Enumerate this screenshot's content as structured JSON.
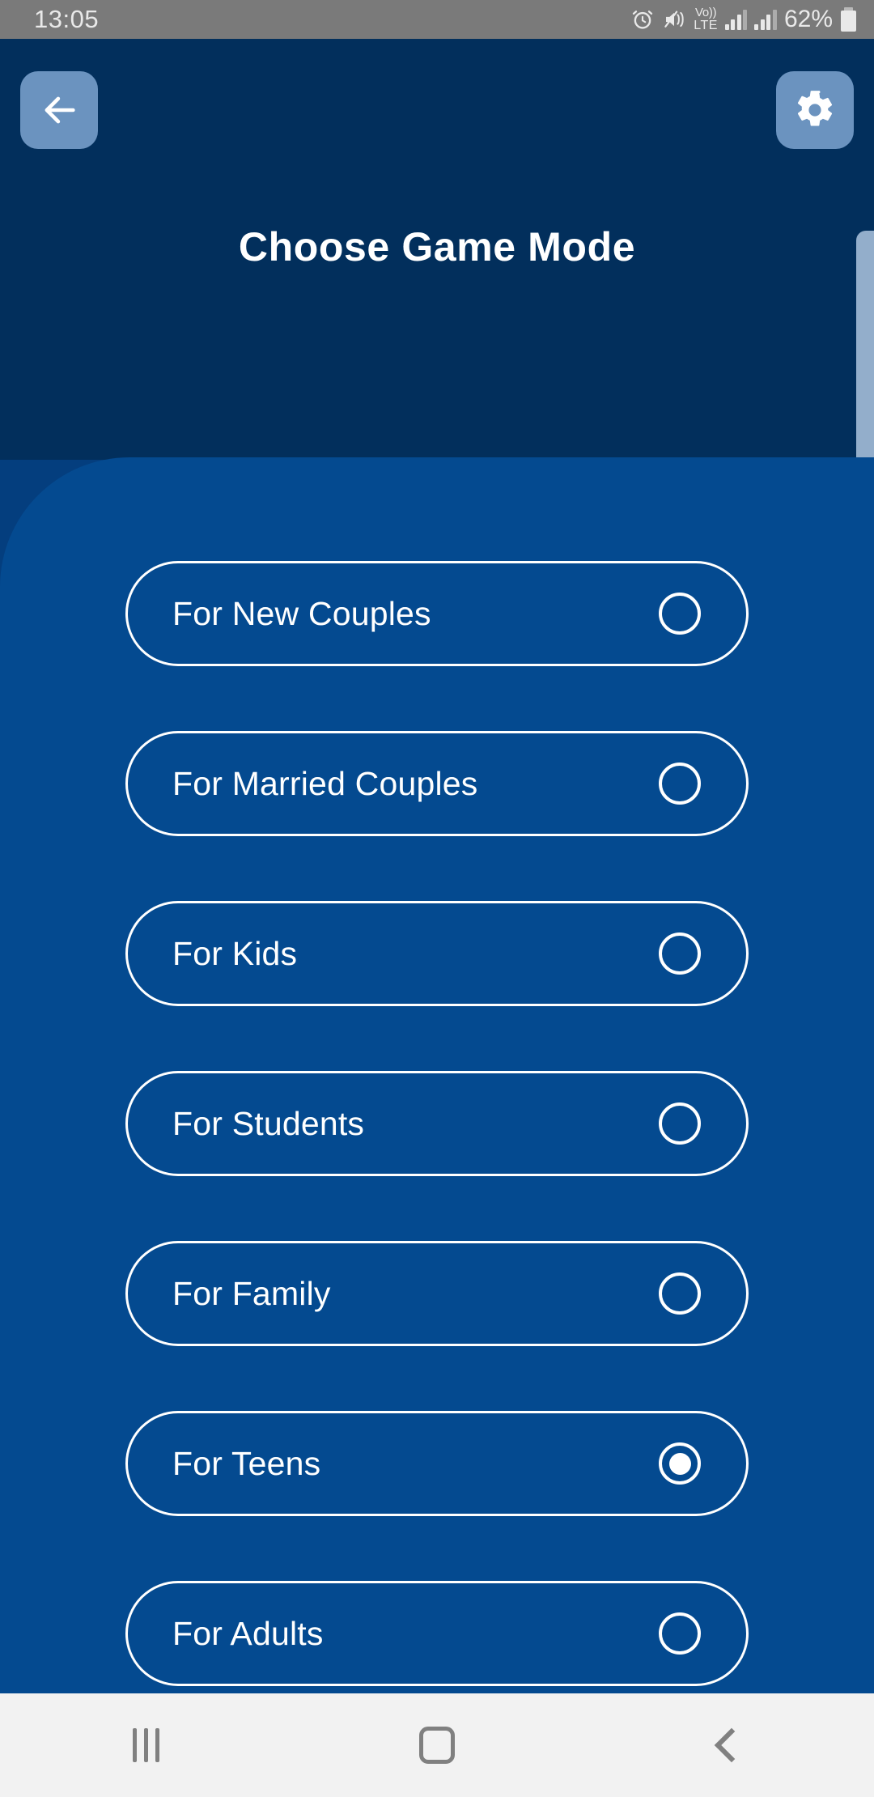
{
  "status_bar": {
    "time": "13:05",
    "battery_percent": "62%",
    "network_top": "Vo))",
    "network_bottom": "LTE",
    "icons": [
      "alarm-icon",
      "mute-vibrate-icon",
      "volte-icon",
      "signal-bars-sim1",
      "signal-bars-sim2",
      "battery-icon"
    ]
  },
  "header": {
    "title": "Choose Game Mode",
    "back_button": "back-arrow",
    "settings_button": "gear",
    "background_color": "#022f5c",
    "button_color": "#6b93bf"
  },
  "panel": {
    "background_color": "#044a90"
  },
  "options": [
    {
      "label": "For New Couples",
      "selected": false
    },
    {
      "label": "For Married Couples",
      "selected": false
    },
    {
      "label": "For Kids",
      "selected": false
    },
    {
      "label": "For Students",
      "selected": false
    },
    {
      "label": "For Family",
      "selected": false
    },
    {
      "label": "For Teens",
      "selected": true
    },
    {
      "label": "For Adults",
      "selected": false
    }
  ],
  "selected_option": "For Teens",
  "bottom_nav": {
    "recents": "recents-icon",
    "home": "home-icon",
    "back": "back-icon"
  }
}
